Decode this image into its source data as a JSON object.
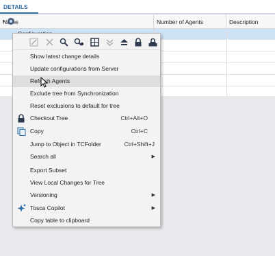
{
  "tabs": {
    "details": "DETAILS"
  },
  "grid": {
    "columns": [
      "Name",
      "Number of Agents",
      "Description"
    ],
    "first_row_label": "Configuration"
  },
  "menu": {
    "toolbar_icons": [
      "edit-icon",
      "delete-icon",
      "search-icon",
      "search-settings-icon",
      "grid-icon",
      "collapse-icon",
      "expand-up-icon",
      "lock-icon",
      "lock-multi-icon"
    ],
    "items": [
      {
        "label": "Show latest change details",
        "shortcut": "",
        "submenu": false,
        "icon": ""
      },
      {
        "label": "Update configurations from Server",
        "shortcut": "",
        "submenu": false,
        "icon": ""
      },
      {
        "label": "Refresh Agents",
        "shortcut": "",
        "submenu": false,
        "icon": ""
      },
      {
        "label": "Exclude tree from Synchronization",
        "shortcut": "",
        "submenu": false,
        "icon": ""
      },
      {
        "label": "Reset exclusions to default for tree",
        "shortcut": "",
        "submenu": false,
        "icon": ""
      },
      {
        "label": "Checkout Tree",
        "shortcut": "Ctrl+Alt+O",
        "submenu": false,
        "icon": "lock-icon"
      },
      {
        "label": "Copy",
        "shortcut": "Ctrl+C",
        "submenu": false,
        "icon": "copy-icon"
      },
      {
        "label": "Jump to Object in TCFolder",
        "shortcut": "Ctrl+Shift+J",
        "submenu": false,
        "icon": ""
      },
      {
        "label": "Search all",
        "shortcut": "",
        "submenu": true,
        "icon": ""
      },
      {
        "label": "Export Subset",
        "shortcut": "",
        "submenu": false,
        "icon": ""
      },
      {
        "label": "View Local Changes for Tree",
        "shortcut": "",
        "submenu": false,
        "icon": ""
      },
      {
        "label": "Versioning",
        "shortcut": "",
        "submenu": true,
        "icon": ""
      },
      {
        "label": "Tosca Copilot",
        "shortcut": "",
        "submenu": true,
        "icon": "sparkle-icon"
      },
      {
        "label": "Copy table to clipboard",
        "shortcut": "",
        "submenu": false,
        "icon": ""
      }
    ],
    "highlighted_index": 2
  }
}
